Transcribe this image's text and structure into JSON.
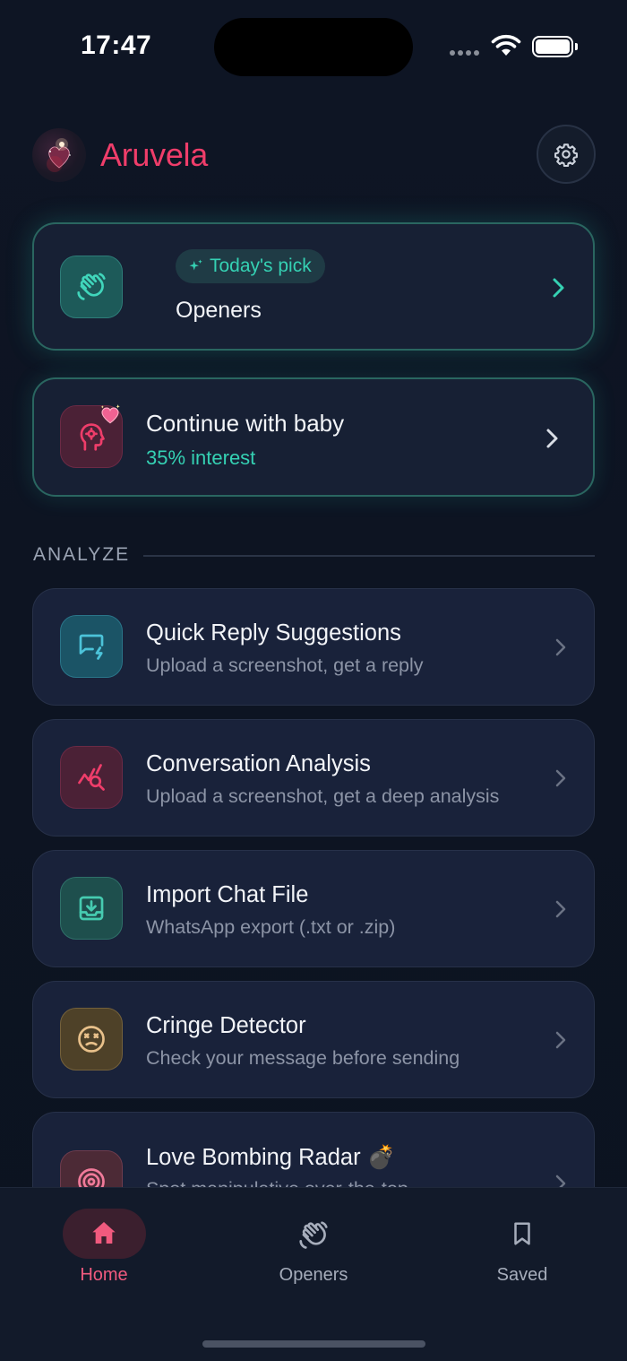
{
  "status_bar": {
    "time": "17:47"
  },
  "header": {
    "app_name": "Aruvela"
  },
  "today_pick": {
    "badge": "Today's pick",
    "title": "Openers"
  },
  "continue_card": {
    "title": "Continue with baby",
    "interest": "35% interest"
  },
  "analyze": {
    "section_label": "ANALYZE",
    "items": [
      {
        "title": "Quick Reply Suggestions",
        "subtitle": "Upload a screenshot, get a reply",
        "icon": "chat-bolt-icon"
      },
      {
        "title": "Conversation Analysis",
        "subtitle": "Upload a screenshot, get a deep analysis",
        "icon": "chart-search-icon"
      },
      {
        "title": "Import Chat File",
        "subtitle": "WhatsApp export (.txt or .zip)",
        "icon": "download-tray-icon"
      },
      {
        "title": "Cringe Detector",
        "subtitle": "Check your message before sending",
        "icon": "dizzy-face-icon"
      },
      {
        "title": "Love Bombing Radar 💣",
        "subtitle": "Spot manipulative over-the-top",
        "icon": "radar-icon"
      }
    ]
  },
  "tabs": [
    {
      "label": "Home",
      "active": true,
      "icon": "home-icon"
    },
    {
      "label": "Openers",
      "active": false,
      "icon": "wave-hand-icon"
    },
    {
      "label": "Saved",
      "active": false,
      "icon": "bookmark-icon"
    }
  ],
  "colors": {
    "accent_pink": "#ef3d6a",
    "accent_teal": "#35d1b3",
    "background": "#0d1422"
  }
}
